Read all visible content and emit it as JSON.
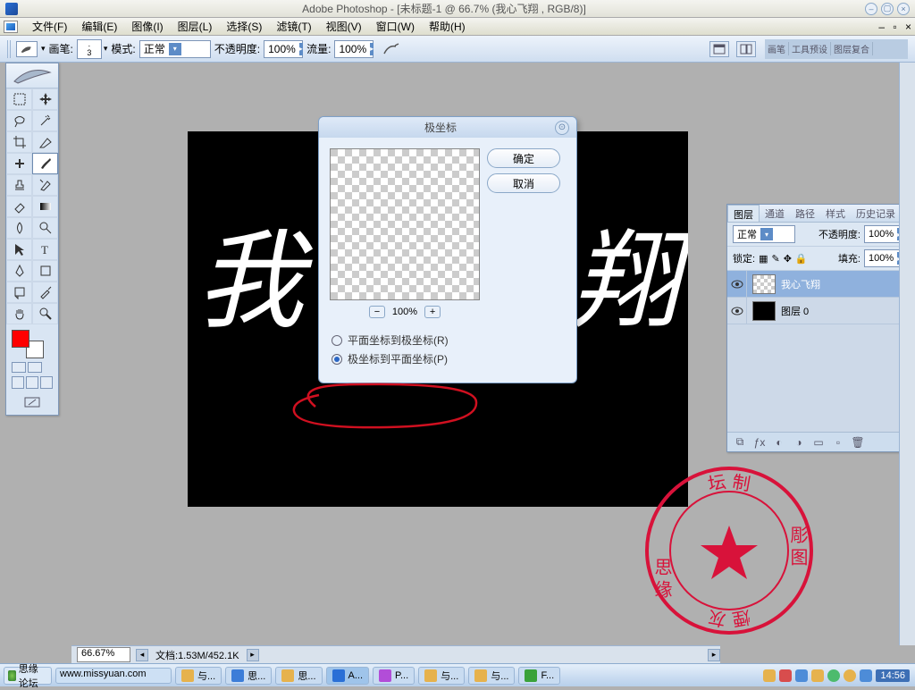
{
  "app": {
    "title": "Adobe Photoshop - [未标题-1 @ 66.7% (我心飞翔   , RGB/8)]"
  },
  "menu": {
    "items": [
      "文件(F)",
      "编辑(E)",
      "图像(I)",
      "图层(L)",
      "选择(S)",
      "滤镜(T)",
      "视图(V)",
      "窗口(W)",
      "帮助(H)"
    ]
  },
  "options": {
    "brush_label": "画笔:",
    "brush_size": "3",
    "mode_label": "模式:",
    "mode_value": "正常",
    "opacity_label": "不透明度:",
    "opacity_value": "100%",
    "flow_label": "流量:",
    "flow_value": "100%",
    "well_tabs": [
      "画笔",
      "工具预设",
      "图层复合"
    ]
  },
  "canvas": {
    "left_char": "我",
    "right_char": "翔"
  },
  "dialog": {
    "title": "极坐标",
    "ok": "确定",
    "cancel": "取消",
    "zoom": "100%",
    "radio1": "平面坐标到极坐标(R)",
    "radio2": "极坐标到平面坐标(P)"
  },
  "layers": {
    "tabs": [
      "图层",
      "通道",
      "路径",
      "样式",
      "历史记录"
    ],
    "blend_value": "正常",
    "opacity_label": "不透明度:",
    "opacity_value": "100%",
    "lock_label": "锁定:",
    "fill_label": "填充:",
    "fill_value": "100%",
    "items": [
      {
        "name": "我心飞翔",
        "selected": true,
        "thumb": "checker"
      },
      {
        "name": "图层 0",
        "selected": false,
        "thumb": "black"
      }
    ]
  },
  "status": {
    "zoom": "66.67%",
    "doc_label": "文档:",
    "doc_value": "1.53M/452.1K"
  },
  "taskbar": {
    "start": "思缘论坛",
    "url": "www.missyuan.com",
    "tasks": [
      {
        "label": "与...",
        "color": "#e6b24d"
      },
      {
        "label": "思...",
        "color": "#3c7dd8"
      },
      {
        "label": "思...",
        "color": "#e6b24d"
      },
      {
        "label": "A...",
        "color": "#2a6fd6",
        "active": true
      },
      {
        "label": "P...",
        "color": "#b24dd8"
      },
      {
        "label": "与...",
        "color": "#e6b24d"
      },
      {
        "label": "与...",
        "color": "#e6b24d"
      },
      {
        "label": "F...",
        "color": "#3aa23a"
      }
    ],
    "clock": "14:56"
  },
  "stamp": {
    "top": "坛 制",
    "right": "彫 图",
    "bottom": "煙 灰",
    "left": "思 缘"
  }
}
